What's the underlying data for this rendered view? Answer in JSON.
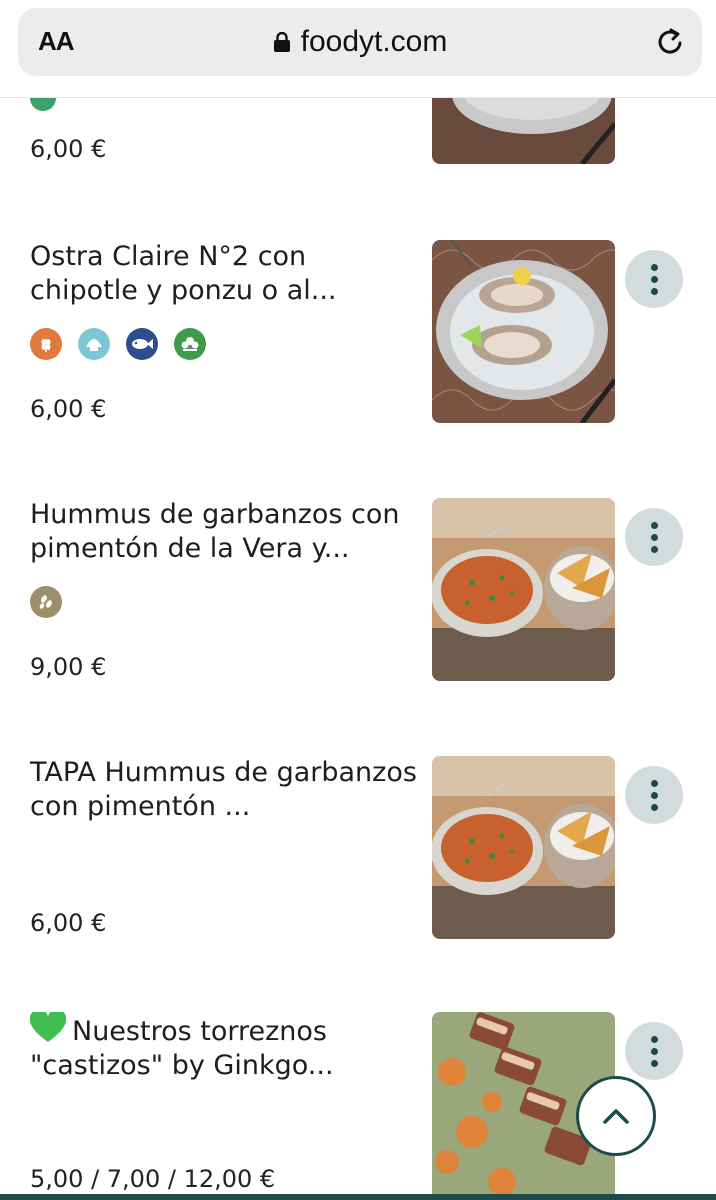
{
  "browser": {
    "text_size_label": "AA",
    "domain": "foodyt.com"
  },
  "items": [
    {
      "title": "",
      "price": "6,00 €",
      "allergens": []
    },
    {
      "title": "Ostra Claire N°2 con chipotle y ponzu o al...",
      "price": "6,00 €",
      "allergens": [
        {
          "name": "gluten-icon",
          "color": "#e07a3a"
        },
        {
          "name": "mollusc-icon",
          "color": "#7cc6d6"
        },
        {
          "name": "fish-icon",
          "color": "#2d4e8c"
        },
        {
          "name": "celery-icon",
          "color": "#3f9a4a"
        }
      ]
    },
    {
      "title": "Hummus de garbanzos con pimentón de la Vera y...",
      "price": "9,00 €",
      "allergens": [
        {
          "name": "sesame-icon",
          "color": "#9b8e6a"
        }
      ]
    },
    {
      "title": "TAPA Hummus de garbanzos con pimentón ...",
      "price": "6,00 €",
      "allergens": []
    },
    {
      "title": "Nuestros torreznos \"castizos\" by Ginkgo...",
      "price": "5,00 / 7,00 / 12,00 €",
      "allergens": [],
      "title_emoji": "green-heart-icon"
    }
  ],
  "colors": {
    "accent": "#1d4b4b",
    "more_button_bg": "#d3dcdc",
    "heart": "#3fbf4f"
  }
}
